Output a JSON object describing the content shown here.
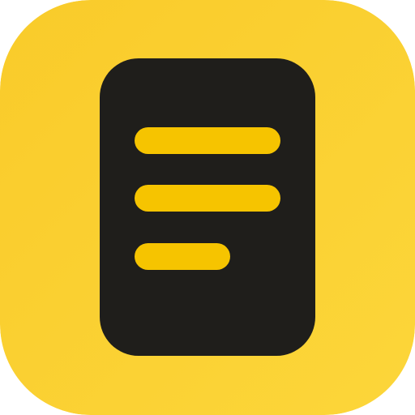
{
  "icon": {
    "name": "notes-app-icon",
    "glyph": "document-lines-icon",
    "colors": {
      "background_top": "#F9CB2A",
      "background_bottom": "#FCD63A",
      "document": "#1F1E1B",
      "lines": "#F6C400"
    }
  }
}
